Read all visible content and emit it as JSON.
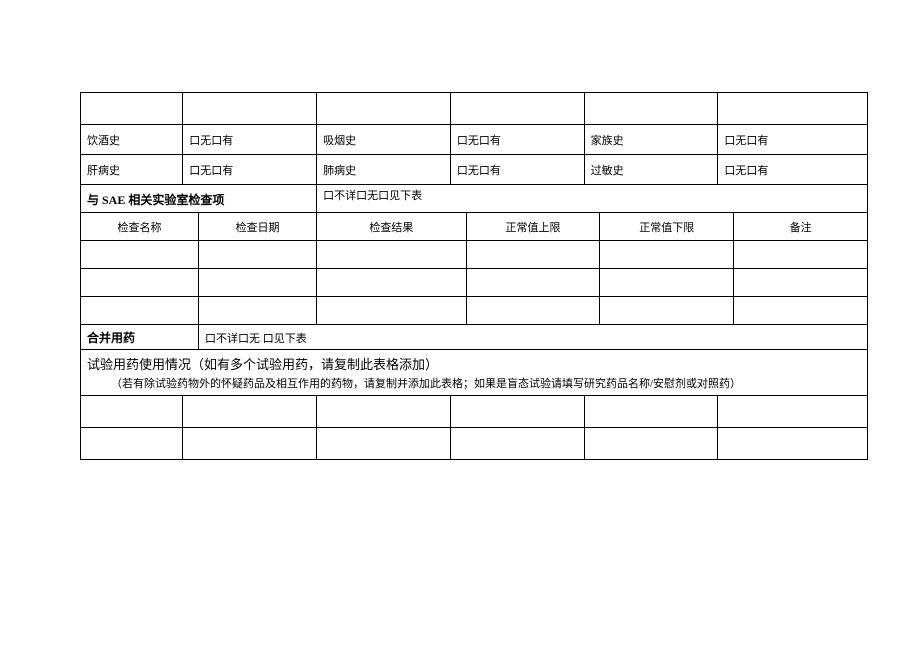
{
  "history": {
    "row0": {
      "c0": "",
      "c1": "",
      "c2": "",
      "c3": "",
      "c4": "",
      "c5": ""
    },
    "row1": {
      "c0": "饮酒史",
      "c1": "口无口有",
      "c2": "吸烟史",
      "c3": "口无口有",
      "c4": "家族史",
      "c5": "口无口有"
    },
    "row2": {
      "c0": "肝病史",
      "c1": "口无口有",
      "c2": "肺病史",
      "c3": "口无口有",
      "c4": "过敏史",
      "c5": "口无口有"
    }
  },
  "lab": {
    "section_label": "与 SAE 相关实验室检查项",
    "section_opts": "口不详口无口见下表",
    "headers": {
      "name": "检查名称",
      "date": "检查日期",
      "result": "检查结果",
      "upper": "正常值上限",
      "lower": "正常值下限",
      "remark": "备注"
    }
  },
  "concomitant": {
    "label": "合并用药",
    "opts": "口不详口无        口见下表"
  },
  "medication": {
    "heading": "试验用药使用情况（如有多个试验用药，请复制此表格添加）",
    "sub": "（若有除试验药物外的怀疑药品及相互作用的药物，请复制并添加此表格；如果是盲态试验请填写研究药品名称/安慰剂或对照药）"
  }
}
